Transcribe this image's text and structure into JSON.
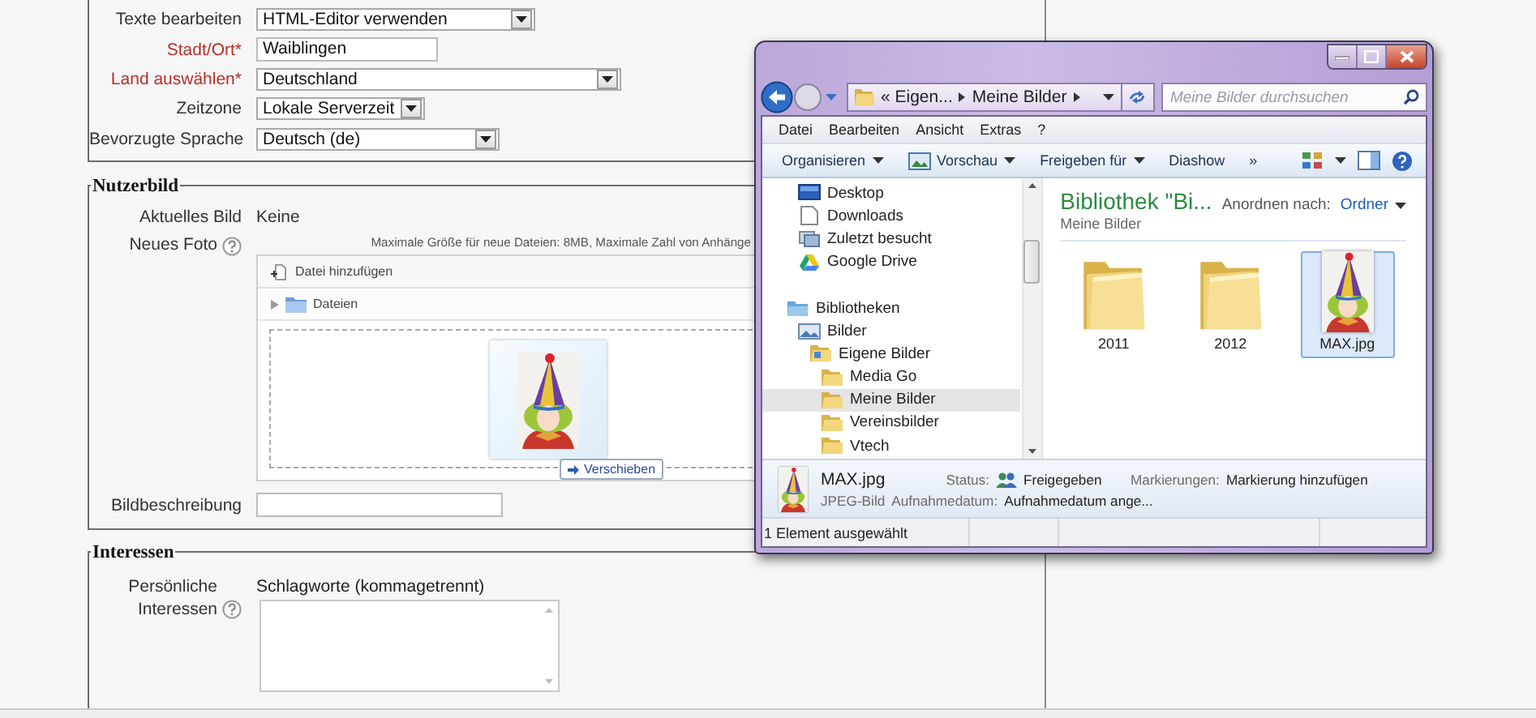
{
  "form": {
    "personal_fields": [
      {
        "label": "Texte bearbeiten",
        "required": false,
        "kind": "select",
        "value": "HTML-Editor verwenden"
      },
      {
        "label": "Stadt/Ort*",
        "required": true,
        "kind": "text",
        "value": "Waiblingen"
      },
      {
        "label": "Land auswählen*",
        "required": true,
        "kind": "select",
        "value": "Deutschland"
      },
      {
        "label": "Zeitzone",
        "required": false,
        "kind": "select",
        "value": "Lokale Serverzeit"
      },
      {
        "label": "Bevorzugte Sprache",
        "required": false,
        "kind": "select",
        "value": "Deutsch (de)"
      }
    ],
    "user_picture": {
      "legend": "Nutzerbild",
      "current_label": "Aktuelles Bild",
      "current_value": "Keine",
      "new_photo_label": "Neues Foto",
      "limits": "Maximale Größe für neue Dateien: 8MB, Maximale Zahl von Anhänge",
      "add_file": "Datei hinzufügen",
      "folder": "Dateien",
      "drag_tooltip": "Verschieben",
      "description_label": "Bildbeschreibung"
    },
    "interests": {
      "legend": "Interessen",
      "label": "Persönliche Interessen",
      "hint": "Schlagworte (kommagetrennt)"
    }
  },
  "explorer": {
    "breadcrumb": [
      "« Eigen...",
      "Meine Bilder"
    ],
    "search": {
      "placeholder": "Meine Bilder durchsuchen"
    },
    "menu": [
      "Datei",
      "Bearbeiten",
      "Ansicht",
      "Extras",
      "?"
    ],
    "toolbar": [
      {
        "label": "Organisieren",
        "kind": "menu",
        "dropdown": true
      },
      {
        "label": "Vorschau",
        "kind": "preview",
        "dropdown": true
      },
      {
        "label": "Freigeben für",
        "kind": "menu",
        "dropdown": true
      },
      {
        "label": "Diashow",
        "kind": "menu",
        "dropdown": false
      },
      {
        "label": "»",
        "kind": "more",
        "dropdown": false
      }
    ],
    "favorites": [
      {
        "label": "Desktop",
        "kind": "desktop",
        "selected": false
      },
      {
        "label": "Downloads",
        "kind": "document",
        "selected": false
      },
      {
        "label": "Zuletzt besucht",
        "kind": "recent",
        "selected": false
      },
      {
        "label": "Google Drive",
        "kind": "drive",
        "selected": false
      }
    ],
    "libraries": [
      {
        "label": "Bibliotheken",
        "kind": "library",
        "selected": false,
        "children": [
          {
            "label": "Bilder",
            "kind": "pictures",
            "selected": false,
            "children": [
              {
                "label": "Eigene Bilder",
                "kind": "picture-folder",
                "selected": false,
                "children": [
                  {
                    "label": "Media Go",
                    "kind": "folder",
                    "selected": false
                  },
                  {
                    "label": "Meine Bilder",
                    "kind": "folder",
                    "selected": true
                  },
                  {
                    "label": "Vereinsbilder",
                    "kind": "folder",
                    "selected": false
                  },
                  {
                    "label": "Vtech",
                    "kind": "folder",
                    "selected": false
                  }
                ]
              }
            ]
          }
        ]
      }
    ],
    "library_title": "Bibliothek \"Bi...",
    "library_subtitle": "Meine Bilder",
    "arrange_label": "Anordnen nach:",
    "arrange_value": "Ordner",
    "files": [
      {
        "name": "2011",
        "kind": "folder",
        "selected": false
      },
      {
        "name": "2012",
        "kind": "folder",
        "selected": false
      },
      {
        "name": "MAX.jpg",
        "kind": "picture",
        "selected": true
      }
    ],
    "details": {
      "name": "MAX.jpg",
      "type": "JPEG-Bild",
      "status_label": "Status:",
      "status_value": "Freigegeben",
      "tags_label": "Markierungen:",
      "tags_value": "Markierung hinzufügen",
      "date_label": "Aufnahmedatum:",
      "date_value": "Aufnahmedatum ange..."
    },
    "status_bar": "1 Element ausgewählt"
  }
}
